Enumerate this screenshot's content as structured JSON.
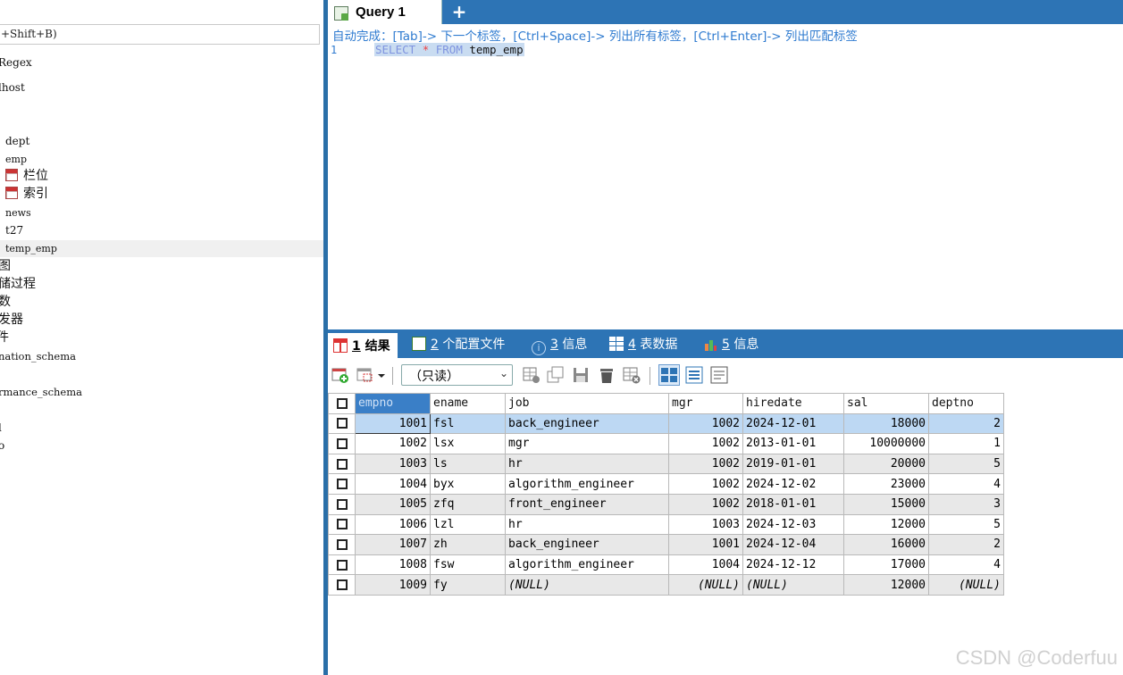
{
  "sidebar": {
    "filter_text": "+Shift+B)",
    "items": [
      {
        "label": "Regex"
      },
      {
        "label": "lhost"
      },
      {
        "label": "dept"
      },
      {
        "label": "emp"
      },
      {
        "label": "栏位"
      },
      {
        "label": "索引"
      },
      {
        "label": "news"
      },
      {
        "label": "t27"
      },
      {
        "label": "temp_emp"
      },
      {
        "label": "图"
      },
      {
        "label": "储过程"
      },
      {
        "label": "数"
      },
      {
        "label": "发器"
      },
      {
        "label": "件"
      },
      {
        "label": "nation_schema"
      },
      {
        "label": "rmance_schema"
      },
      {
        "label": "l"
      },
      {
        "label": "o"
      }
    ]
  },
  "editor": {
    "tab_label": "Query 1",
    "add_tab_label": "+",
    "autocomplete_hint": "自动完成：[Tab]-> 下一个标签，[Ctrl+Space]-> 列出所有标签，[Ctrl+Enter]-> 列出匹配标签",
    "line_number": "1",
    "sql": {
      "select": "SELECT",
      "star": "*",
      "from": "FROM",
      "table": "temp_emp"
    }
  },
  "results_tabs": [
    {
      "num": "1",
      "label": "结果",
      "icon": "result-grid-icon",
      "active": true
    },
    {
      "num": "2",
      "label": "个配置文件",
      "icon": "profile-icon"
    },
    {
      "num": "3",
      "label": "信息",
      "icon": "info-icon"
    },
    {
      "num": "4",
      "label": "表数据",
      "icon": "table-data-icon"
    },
    {
      "num": "5",
      "label": "信息",
      "icon": "chart-icon"
    }
  ],
  "toolbar": {
    "readonly_label": "（只读）",
    "caret": "⌄"
  },
  "grid": {
    "columns": [
      "empno",
      "ename",
      "job",
      "mgr",
      "hiredate",
      "sal",
      "deptno"
    ],
    "rows": [
      [
        "1001",
        "fsl",
        "back_engineer",
        "1002",
        "2024-12-01",
        "18000",
        "2"
      ],
      [
        "1002",
        "lsx",
        "mgr",
        "1002",
        "2013-01-01",
        "10000000",
        "1"
      ],
      [
        "1003",
        "ls",
        "hr",
        "1002",
        "2019-01-01",
        "20000",
        "5"
      ],
      [
        "1004",
        "byx",
        "algorithm_engineer",
        "1002",
        "2024-12-02",
        "23000",
        "4"
      ],
      [
        "1005",
        "zfq",
        "front_engineer",
        "1002",
        "2018-01-01",
        "15000",
        "3"
      ],
      [
        "1006",
        "lzl",
        "hr",
        "1003",
        "2024-12-03",
        "12000",
        "5"
      ],
      [
        "1007",
        "zh",
        "back_engineer",
        "1001",
        "2024-12-04",
        "16000",
        "2"
      ],
      [
        "1008",
        "fsw",
        "algorithm_engineer",
        "1004",
        "2024-12-12",
        "17000",
        "4"
      ],
      [
        "1009",
        "fy",
        "(NULL)",
        "(NULL)",
        "(NULL)",
        "12000",
        "(NULL)"
      ]
    ]
  },
  "watermark": "CSDN @Coderfuu",
  "colors": {
    "accent": "#2d74b5",
    "selected_row": "#bdd8f3",
    "keyword": "#7f94e0"
  }
}
